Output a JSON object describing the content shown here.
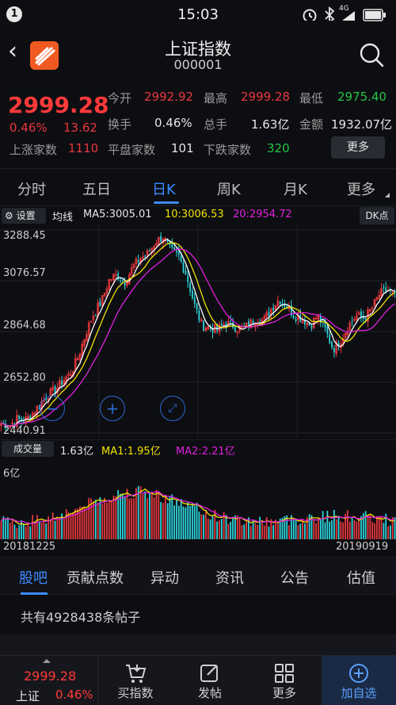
{
  "status_bar": {
    "badge": "1",
    "time": "15:03",
    "network": "4G"
  },
  "header": {
    "title": "上证指数",
    "code": "000001"
  },
  "quote": {
    "price": "2999.28",
    "pct": "0.46%",
    "change": "13.62",
    "fields": [
      {
        "label": "今开",
        "value": "2992.92",
        "color": "red"
      },
      {
        "label": "最高",
        "value": "2999.28",
        "color": "red"
      },
      {
        "label": "最低",
        "value": "2975.40",
        "color": "green"
      },
      {
        "label": "换手",
        "value": "0.46%",
        "color": "white"
      },
      {
        "label": "总手",
        "value": "1.63亿",
        "color": "white"
      },
      {
        "label": "金额",
        "value": "1932.07亿",
        "color": "white"
      }
    ],
    "breadth": [
      {
        "label": "上涨家数",
        "value": "1110",
        "color": "red"
      },
      {
        "label": "平盘家数",
        "value": "101",
        "color": "white"
      },
      {
        "label": "下跌家数",
        "value": "320",
        "color": "green"
      }
    ],
    "more_button": "更多"
  },
  "period_tabs": [
    {
      "label": "分时",
      "active": false
    },
    {
      "label": "五日",
      "active": false
    },
    {
      "label": "日K",
      "active": true
    },
    {
      "label": "周K",
      "active": false
    },
    {
      "label": "月K",
      "active": false
    },
    {
      "label": "更多",
      "active": false
    }
  ],
  "ma_bar": {
    "settings": "设置",
    "label": "均线",
    "ma5": "MA5:3005.01",
    "ma10": "10:3006.53",
    "ma20": "20:2954.72",
    "dk_button": "DK点"
  },
  "colors": {
    "up": "#e8383d",
    "down": "#2ed8e0",
    "ma5": "#ffffff",
    "ma10": "#f2e200",
    "ma20": "#e020e0",
    "accent": "#3c8bff"
  },
  "chart_data": {
    "type": "candlestick",
    "ylim": [
      2440.91,
      3288.45
    ],
    "y_ticks": [
      "3288.45",
      "3076.57",
      "2864.68",
      "2652.80",
      "2440.91"
    ],
    "x_range": [
      "20181225",
      "20190919"
    ],
    "close_trend": [
      2480,
      2470,
      2500,
      2490,
      2520,
      2560,
      2600,
      2620,
      2660,
      2690,
      2760,
      2860,
      2940,
      2990,
      3080,
      3100,
      3070,
      3130,
      3170,
      3190,
      3240,
      3260,
      3200,
      3180,
      3100,
      2980,
      2890,
      2880,
      2870,
      2900,
      2890,
      2870,
      2890,
      2920,
      2910,
      2960,
      3000,
      2970,
      2930,
      2920,
      2890,
      2930,
      2870,
      2790,
      2830,
      2890,
      2930,
      2920,
      2960,
      3020,
      3040,
      3010
    ],
    "volume_label": "成交量",
    "volume": "1.63亿",
    "vol_ma1": "MA1:1.95亿",
    "vol_ma2": "MA2:2.21亿",
    "volume_axis_max": "6亿"
  },
  "bottom_tabs": [
    {
      "label": "股吧",
      "active": true
    },
    {
      "label": "贡献点数",
      "active": false
    },
    {
      "label": "异动",
      "active": false
    },
    {
      "label": "资讯",
      "active": false
    },
    {
      "label": "公告",
      "active": false
    },
    {
      "label": "估值",
      "active": false
    }
  ],
  "posts_text": "共有4928438条帖子",
  "bottom_nav": {
    "price": "2999.28",
    "name": "上证",
    "pct": "0.46%",
    "items": [
      {
        "label": "买指数",
        "icon": "buy-index-icon"
      },
      {
        "label": "发帖",
        "icon": "compose-icon"
      },
      {
        "label": "更多",
        "icon": "grid-icon"
      },
      {
        "label": "加自选",
        "icon": "add-watchlist-icon"
      }
    ]
  }
}
